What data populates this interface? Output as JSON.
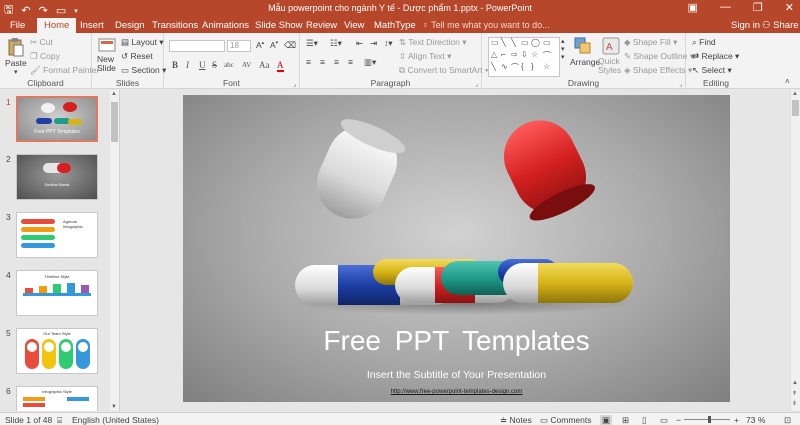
{
  "titlebar": {
    "title": "Mẫu powerpoint cho ngành Y tế - Dược phẩm 1.pptx - PowerPoint",
    "save_icon": "save-icon",
    "undo_icon": "undo-icon",
    "redo_icon": "redo-icon",
    "present_icon": "present-icon",
    "minimize": "—",
    "restore": "❐",
    "close": "✕",
    "ribbon_options": "▣"
  },
  "tabs": [
    {
      "label": "File"
    },
    {
      "label": "Home"
    },
    {
      "label": "Insert"
    },
    {
      "label": "Design"
    },
    {
      "label": "Transitions"
    },
    {
      "label": "Animations"
    },
    {
      "label": "Slide Show"
    },
    {
      "label": "Review"
    },
    {
      "label": "View"
    },
    {
      "label": "MathType"
    }
  ],
  "active_tab": "Home",
  "tell_me": "Tell me what you want to do...",
  "sign_in": "Sign in",
  "share": "Share",
  "ribbon": {
    "clipboard": {
      "label": "Clipboard",
      "paste": "Paste",
      "cut": "Cut",
      "copy": "Copy",
      "format_painter": "Format Painter"
    },
    "slides": {
      "label": "Slides",
      "new_slide": "New Slide",
      "layout": "Layout",
      "reset": "Reset",
      "section": "Section"
    },
    "font": {
      "label": "Font",
      "font_name": "",
      "font_size": "18",
      "bold": "B",
      "italic": "I",
      "underline": "U",
      "strike": "S",
      "shadow": "abc",
      "spacing": "AV",
      "case": "Aa",
      "color": "A"
    },
    "paragraph": {
      "label": "Paragraph",
      "text_direction": "Text Direction",
      "align_text": "Align Text",
      "convert_smartart": "Convert to SmartArt"
    },
    "drawing": {
      "label": "Drawing",
      "arrange": "Arrange",
      "quick_styles": "Quick Styles",
      "shape_fill": "Shape Fill",
      "shape_outline": "Shape Outline",
      "shape_effects": "Shape Effects"
    },
    "editing": {
      "label": "Editing",
      "find": "Find",
      "replace": "Replace",
      "select": "Select"
    }
  },
  "thumbnails": [
    {
      "num": "1",
      "title": "Free PPT Templates",
      "active": true
    },
    {
      "num": "2",
      "title": "Section Break",
      "active": false
    },
    {
      "num": "3",
      "title": "Agenda Infographic",
      "active": false
    },
    {
      "num": "4",
      "title": "Timeline Style",
      "active": false
    },
    {
      "num": "5",
      "title": "Our Team Style",
      "active": false
    },
    {
      "num": "6",
      "title": "Infographic Style",
      "active": false
    }
  ],
  "slide": {
    "title": "Free  PPT Templates",
    "subtitle": "Insert the Subtitle of Your Presentation",
    "url": "http://www.free-powerpoint-templates-design.com"
  },
  "status": {
    "slide_of": "Slide 1 of 48",
    "language": "English (United States)",
    "notes": "Notes",
    "comments": "Comments",
    "zoom": "73 %",
    "zoom_minus": "−",
    "zoom_plus": "+"
  },
  "colors": {
    "accent": "#b7472a",
    "pill_red": "#d42020",
    "pill_blue": "#1d3fa6",
    "pill_yellow": "#d6b418",
    "pill_teal": "#1f9c8a"
  }
}
